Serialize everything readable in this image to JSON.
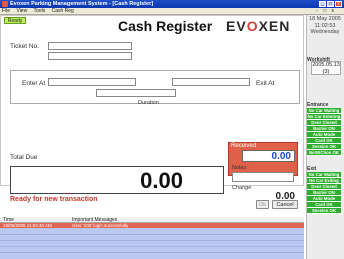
{
  "window": {
    "title": "Evoxen Parking Management System - [Cash Register]",
    "buttons": [
      "_",
      "□",
      "x"
    ]
  },
  "menu": {
    "items": [
      "File",
      "View",
      "Tools",
      "Cash Reg"
    ],
    "mdi_controls": "- □ x"
  },
  "status_badge": "Ready",
  "header": {
    "title": "Cash Register",
    "logo_left": "EV",
    "logo_o": "O",
    "logo_right": "XEN"
  },
  "ticket": {
    "label": "Ticket No."
  },
  "times": {
    "enter_label": "Enter At",
    "exit_label": "Exit At",
    "duration_label": "Duration"
  },
  "totals": {
    "total_due_label": "Total Due",
    "total_due_value": "0.00",
    "received_label": "Received",
    "received_value": "0.00",
    "notes_label": "Notes",
    "change_label": "Change",
    "change_value": "0.00"
  },
  "status_message": "Ready for new transaction",
  "buttons": {
    "ok": "Ok",
    "cancel": "Cancel"
  },
  "messages": {
    "col_time": "Time",
    "col_message": "Important Messages",
    "rows": [
      {
        "time": "18/05/2005 11:02:40 AM",
        "message": "User '100' login successfully"
      }
    ]
  },
  "sidebar": {
    "date_line1": "18 May 2005",
    "date_line2": "11:02:53",
    "date_line3": "Wednesday",
    "workshift_label": "Workshift",
    "workshift_date": "2005.05.13",
    "workshift_number": "(3)",
    "entrance_label": "Entrance",
    "entrance_buttons": [
      "No Car Waiting",
      "No Car Entering",
      "Door Closed",
      "Barrier ON",
      "Auto Mode",
      "Card OK",
      "Session OK",
      "NoSECtion OK"
    ],
    "exit_label": "Exit",
    "exit_buttons": [
      "No Car Waiting",
      "No Car Exiting",
      "Door Closed",
      "Barrier ON",
      "Auto Mode",
      "Card OK",
      "Session OK"
    ]
  },
  "colors": {
    "accent_red": "#e0604a",
    "status_green": "#2fae2f",
    "title_blue": "#0a36b0",
    "grid_blue": "#b9c9f2"
  }
}
